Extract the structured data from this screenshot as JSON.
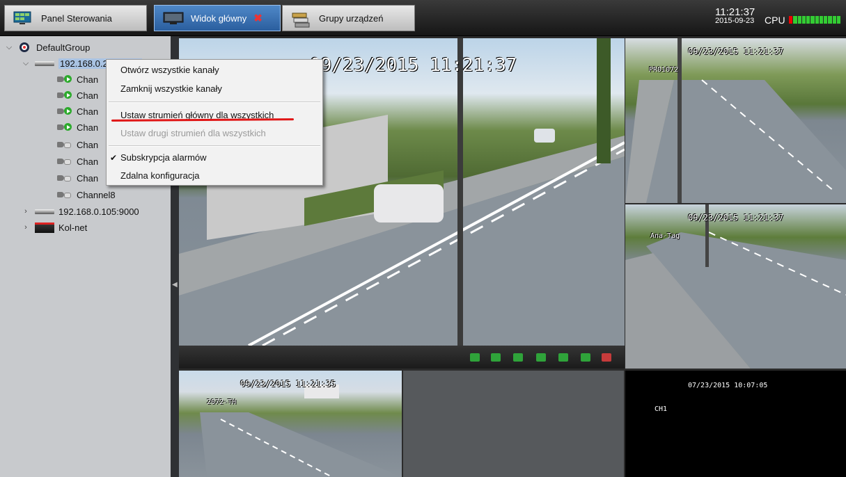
{
  "tabs": [
    {
      "label": "Panel Sterowania",
      "active": false
    },
    {
      "label": "Widok główny",
      "active": true,
      "closable": true
    },
    {
      "label": "Grupy urządzeń",
      "active": false
    }
  ],
  "status": {
    "time": "11:21:37",
    "date": "2015-09-23",
    "cpu_label": "CPU",
    "colors": {
      "cpu_low": "#33cc33",
      "cpu_high": "#e00000"
    }
  },
  "tree": {
    "root": {
      "label": "DefaultGroup"
    },
    "devices": [
      {
        "label": "192.168.0.239:9000",
        "expanded": true
      },
      {
        "label": "192.168.0.105:9000",
        "expanded": false
      },
      {
        "label": "Kol-net",
        "expanded": false
      }
    ],
    "channels": [
      {
        "label": "Chan",
        "playing": true
      },
      {
        "label": "Chan",
        "playing": true
      },
      {
        "label": "Chan",
        "playing": true
      },
      {
        "label": "Chan",
        "playing": true
      },
      {
        "label": "Chan",
        "playing": false
      },
      {
        "label": "Chan",
        "playing": false
      },
      {
        "label": "Chan",
        "playing": false
      },
      {
        "label": "Channel8",
        "playing": false
      }
    ]
  },
  "context_menu": {
    "items": [
      {
        "label": "Otwórz wszystkie kanały",
        "enabled": true
      },
      {
        "label": "Zamknij wszystkie kanały",
        "enabled": true
      },
      {
        "label": "Ustaw strumień główny dla wszystkich",
        "enabled": true,
        "highlighted": true
      },
      {
        "label": "Ustaw drugi strumień dla wszystkich",
        "enabled": false
      },
      {
        "label": "Subskrypcja alarmów",
        "enabled": true,
        "checked": true
      },
      {
        "label": "Zdalna konfiguracja",
        "enabled": true
      }
    ],
    "check_mark": "✔"
  },
  "videos": {
    "main": {
      "timestamp": "09/23/2015 11:21:37"
    },
    "top_right": {
      "timestamp": "09/23/2015 11:21:37",
      "camera": "PR01072"
    },
    "mid_right": {
      "timestamp": "09/23/2015 11:21:37",
      "camera": "Ana-Tag"
    },
    "bottom_left": {
      "timestamp": "09/23/2015 11:21:35",
      "camera": "2072-TH"
    },
    "bottom_right": {
      "timestamp": "07/23/2015 10:07:05",
      "camera": "CH1"
    }
  },
  "toolbar_icons": [
    "camera-icon",
    "record-icon",
    "person-icon",
    "stop-icon",
    "zoom-in-icon",
    "ptz-icon",
    "mute-icon"
  ]
}
